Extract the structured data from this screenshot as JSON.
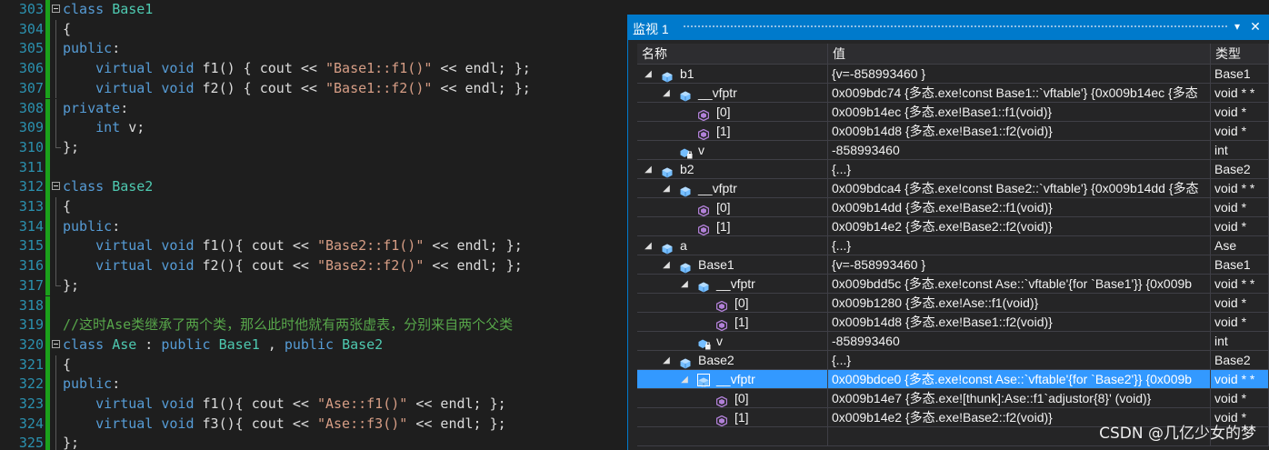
{
  "editor": {
    "lines": [
      {
        "num": "303",
        "fold": true,
        "indent": 0,
        "tokens": [
          [
            "kw",
            "class"
          ],
          [
            "pl",
            " "
          ],
          [
            "ty",
            "Base1"
          ]
        ]
      },
      {
        "num": "304",
        "fold": false,
        "indent": 0,
        "tokens": [
          [
            "pl",
            "{"
          ]
        ]
      },
      {
        "num": "305",
        "fold": false,
        "indent": 0,
        "tokens": [
          [
            "kw",
            "public"
          ],
          [
            "pl",
            ":"
          ]
        ]
      },
      {
        "num": "306",
        "fold": false,
        "indent": 0,
        "tokens": [
          [
            "pl",
            "    "
          ],
          [
            "kw",
            "virtual"
          ],
          [
            "pl",
            " "
          ],
          [
            "kw",
            "void"
          ],
          [
            "pl",
            " f1() { cout << "
          ],
          [
            "st",
            "\"Base1::f1()\""
          ],
          [
            "pl",
            " << endl; };"
          ]
        ]
      },
      {
        "num": "307",
        "fold": false,
        "indent": 0,
        "tokens": [
          [
            "pl",
            "    "
          ],
          [
            "kw",
            "virtual"
          ],
          [
            "pl",
            " "
          ],
          [
            "kw",
            "void"
          ],
          [
            "pl",
            " f2() { cout << "
          ],
          [
            "st",
            "\"Base1::f2()\""
          ],
          [
            "pl",
            " << endl; };"
          ]
        ]
      },
      {
        "num": "308",
        "fold": false,
        "indent": 0,
        "tokens": [
          [
            "kw",
            "private"
          ],
          [
            "pl",
            ":"
          ]
        ]
      },
      {
        "num": "309",
        "fold": false,
        "indent": 0,
        "tokens": [
          [
            "pl",
            "    "
          ],
          [
            "kw",
            "int"
          ],
          [
            "pl",
            " v;"
          ]
        ]
      },
      {
        "num": "310",
        "fold": false,
        "indent": 0,
        "end": true,
        "tokens": [
          [
            "pl",
            "};"
          ]
        ]
      },
      {
        "num": "311",
        "fold": false,
        "indent": 0,
        "none": true,
        "tokens": []
      },
      {
        "num": "312",
        "fold": true,
        "indent": 0,
        "tokens": [
          [
            "kw",
            "class"
          ],
          [
            "pl",
            " "
          ],
          [
            "ty",
            "Base2"
          ]
        ]
      },
      {
        "num": "313",
        "fold": false,
        "indent": 0,
        "tokens": [
          [
            "pl",
            "{"
          ]
        ]
      },
      {
        "num": "314",
        "fold": false,
        "indent": 0,
        "tokens": [
          [
            "kw",
            "public"
          ],
          [
            "pl",
            ":"
          ]
        ]
      },
      {
        "num": "315",
        "fold": false,
        "indent": 0,
        "tokens": [
          [
            "pl",
            "    "
          ],
          [
            "kw",
            "virtual"
          ],
          [
            "pl",
            " "
          ],
          [
            "kw",
            "void"
          ],
          [
            "pl",
            " f1(){ cout << "
          ],
          [
            "st",
            "\"Base2::f1()\""
          ],
          [
            "pl",
            " << endl; };"
          ]
        ]
      },
      {
        "num": "316",
        "fold": false,
        "indent": 0,
        "tokens": [
          [
            "pl",
            "    "
          ],
          [
            "kw",
            "virtual"
          ],
          [
            "pl",
            " "
          ],
          [
            "kw",
            "void"
          ],
          [
            "pl",
            " f2(){ cout << "
          ],
          [
            "st",
            "\"Base2::f2()\""
          ],
          [
            "pl",
            " << endl; };"
          ]
        ]
      },
      {
        "num": "317",
        "fold": false,
        "indent": 0,
        "end": true,
        "tokens": [
          [
            "pl",
            "};"
          ]
        ]
      },
      {
        "num": "318",
        "fold": false,
        "indent": 0,
        "none": true,
        "tokens": []
      },
      {
        "num": "319",
        "fold": false,
        "indent": 0,
        "none": true,
        "tokens": [
          [
            "cm",
            "//这时Ase类继承了两个类，那么此时他就有两张虚表，分别来自两个父类"
          ]
        ]
      },
      {
        "num": "320",
        "fold": true,
        "indent": 0,
        "tokens": [
          [
            "kw",
            "class"
          ],
          [
            "pl",
            " "
          ],
          [
            "ty",
            "Ase"
          ],
          [
            "pl",
            " : "
          ],
          [
            "kw",
            "public"
          ],
          [
            "pl",
            " "
          ],
          [
            "ty",
            "Base1"
          ],
          [
            "pl",
            " , "
          ],
          [
            "kw",
            "public"
          ],
          [
            "pl",
            " "
          ],
          [
            "ty",
            "Base2"
          ]
        ]
      },
      {
        "num": "321",
        "fold": false,
        "indent": 0,
        "tokens": [
          [
            "pl",
            "{"
          ]
        ]
      },
      {
        "num": "322",
        "fold": false,
        "indent": 0,
        "tokens": [
          [
            "kw",
            "public"
          ],
          [
            "pl",
            ":"
          ]
        ]
      },
      {
        "num": "323",
        "fold": false,
        "indent": 0,
        "tokens": [
          [
            "pl",
            "    "
          ],
          [
            "kw",
            "virtual"
          ],
          [
            "pl",
            " "
          ],
          [
            "kw",
            "void"
          ],
          [
            "pl",
            " f1(){ cout << "
          ],
          [
            "st",
            "\"Ase::f1()\""
          ],
          [
            "pl",
            " << endl; };"
          ]
        ]
      },
      {
        "num": "324",
        "fold": false,
        "indent": 0,
        "tokens": [
          [
            "pl",
            "    "
          ],
          [
            "kw",
            "virtual"
          ],
          [
            "pl",
            " "
          ],
          [
            "kw",
            "void"
          ],
          [
            "pl",
            " f3(){ cout << "
          ],
          [
            "st",
            "\"Ase::f3()\""
          ],
          [
            "pl",
            " << endl; };"
          ]
        ]
      },
      {
        "num": "325",
        "fold": false,
        "indent": 0,
        "tokens": [
          [
            "pl",
            "};"
          ]
        ]
      }
    ]
  },
  "watch": {
    "title": "监视 1",
    "pin_icon": "pin-icon",
    "close_icon": "close-icon",
    "columns": {
      "name": "名称",
      "value": "值",
      "type": "类型"
    },
    "rows": [
      {
        "level": 0,
        "exp": "open",
        "icon": "object",
        "name": "b1",
        "value": "{v=-858993460 }",
        "type": "Base1"
      },
      {
        "level": 1,
        "exp": "open",
        "icon": "object",
        "name": "__vfptr",
        "value": "0x009bdc74 {多态.exe!const Base1::`vftable'} {0x009b14ec {多态",
        "type": "void * *"
      },
      {
        "level": 2,
        "exp": "none",
        "icon": "method",
        "name": "[0]",
        "value": "0x009b14ec {多态.exe!Base1::f1(void)}",
        "type": "void *"
      },
      {
        "level": 2,
        "exp": "none",
        "icon": "method",
        "name": "[1]",
        "value": "0x009b14d8 {多态.exe!Base1::f2(void)}",
        "type": "void *"
      },
      {
        "level": 1,
        "exp": "none",
        "icon": "private",
        "name": "v",
        "value": "-858993460",
        "type": "int"
      },
      {
        "level": 0,
        "exp": "open",
        "icon": "object",
        "name": "b2",
        "value": "{...}",
        "type": "Base2"
      },
      {
        "level": 1,
        "exp": "open",
        "icon": "object",
        "name": "__vfptr",
        "value": "0x009bdca4 {多态.exe!const Base2::`vftable'} {0x009b14dd {多态",
        "type": "void * *"
      },
      {
        "level": 2,
        "exp": "none",
        "icon": "method",
        "name": "[0]",
        "value": "0x009b14dd {多态.exe!Base2::f1(void)}",
        "type": "void *"
      },
      {
        "level": 2,
        "exp": "none",
        "icon": "method",
        "name": "[1]",
        "value": "0x009b14e2 {多态.exe!Base2::f2(void)}",
        "type": "void *"
      },
      {
        "level": 0,
        "exp": "open",
        "icon": "object",
        "name": "a",
        "value": "{...}",
        "type": "Ase"
      },
      {
        "level": 1,
        "exp": "open",
        "icon": "object",
        "name": "Base1",
        "value": "{v=-858993460 }",
        "type": "Base1"
      },
      {
        "level": 2,
        "exp": "open",
        "icon": "object",
        "name": "__vfptr",
        "value": "0x009bdd5c {多态.exe!const Ase::`vftable'{for `Base1'}} {0x009b",
        "type": "void * *"
      },
      {
        "level": 3,
        "exp": "none",
        "icon": "method",
        "name": "[0]",
        "value": "0x009b1280 {多态.exe!Ase::f1(void)}",
        "type": "void *"
      },
      {
        "level": 3,
        "exp": "none",
        "icon": "method",
        "name": "[1]",
        "value": "0x009b14d8 {多态.exe!Base1::f2(void)}",
        "type": "void *"
      },
      {
        "level": 2,
        "exp": "none",
        "icon": "private",
        "name": "v",
        "value": "-858993460",
        "type": "int"
      },
      {
        "level": 1,
        "exp": "open",
        "icon": "object",
        "name": "Base2",
        "value": "{...}",
        "type": "Base2"
      },
      {
        "level": 2,
        "exp": "open",
        "icon": "object",
        "name": "__vfptr",
        "value": "0x009bdce0 {多态.exe!const Ase::`vftable'{for `Base2'}} {0x009b",
        "type": "void * *",
        "selected": true
      },
      {
        "level": 3,
        "exp": "none",
        "icon": "method",
        "name": "[0]",
        "value": "0x009b14e7 {多态.exe![thunk]:Ase::f1`adjustor{8}' (void)}",
        "type": "void *"
      },
      {
        "level": 3,
        "exp": "none",
        "icon": "method",
        "name": "[1]",
        "value": "0x009b14e2 {多态.exe!Base2::f2(void)}",
        "type": "void *"
      },
      {
        "level": 0,
        "exp": "none",
        "icon": "none",
        "name": "",
        "value": "",
        "type": ""
      }
    ]
  },
  "watermark": "CSDN @几亿少女的梦",
  "colors": {
    "accent": "#007acc",
    "selection": "#3399ff",
    "keyword": "#569cd6",
    "type": "#4ec9b0",
    "string": "#d69d85",
    "comment": "#57a64a",
    "line_number": "#2b91af",
    "change_bar": "#1ba11b"
  }
}
